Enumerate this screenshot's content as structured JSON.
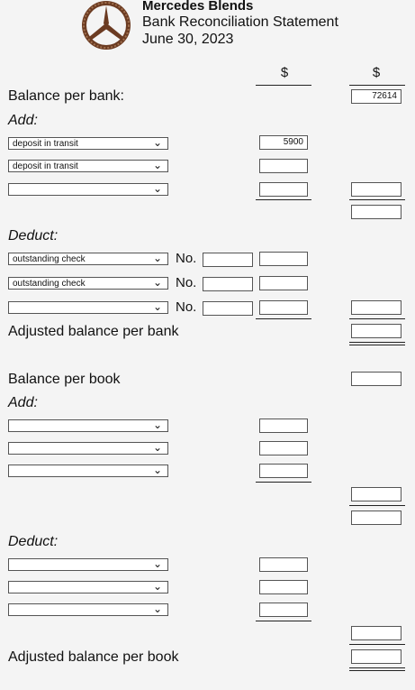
{
  "header": {
    "company": "Mercedes Blends",
    "title": "Bank Reconciliation Statement",
    "date": "June 30, 2023",
    "col1_symbol": "$",
    "col2_symbol": "$"
  },
  "bank": {
    "balance_label": "Balance per bank:",
    "balance_value": "72614",
    "add_label": "Add:",
    "add_rows": [
      {
        "select": "deposit in transit",
        "amount": "5900"
      },
      {
        "select": "deposit in transit",
        "amount": ""
      },
      {
        "select": "",
        "amount": ""
      }
    ],
    "deduct_label": "Deduct:",
    "no_label": "No.",
    "deduct_rows": [
      {
        "select": "outstanding check",
        "number": "",
        "amount": ""
      },
      {
        "select": "outstanding check",
        "number": "",
        "amount": ""
      },
      {
        "select": "",
        "number": "",
        "amount": ""
      }
    ],
    "adjusted_label": "Adjusted balance per bank"
  },
  "book": {
    "balance_label": "Balance per book",
    "add_label": "Add:",
    "deduct_label": "Deduct:",
    "adjusted_label": "Adjusted balance per book"
  },
  "icons": {
    "logo": "mercedes-star-logo",
    "dropdown": "chevron-down-icon"
  }
}
